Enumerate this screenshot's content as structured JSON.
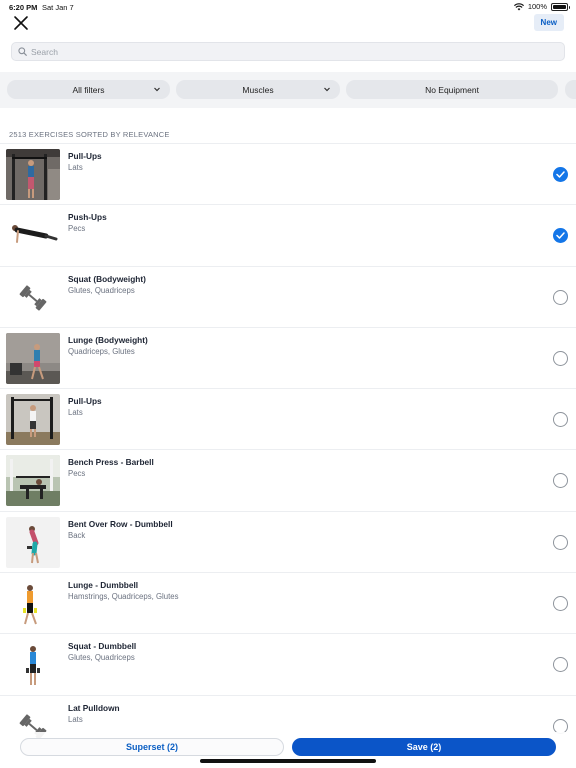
{
  "status_bar": {
    "time": "6:20 PM",
    "date": "Sat Jan 7",
    "battery": "100%"
  },
  "header": {
    "new_label": "New"
  },
  "search": {
    "placeholder": "Search"
  },
  "filters": [
    {
      "label": "All filters",
      "has_dropdown": true
    },
    {
      "label": "Muscles",
      "has_dropdown": true
    },
    {
      "label": "No Equipment",
      "has_dropdown": false
    }
  ],
  "list_header": "2513 EXERCISES SORTED BY RELEVANCE",
  "exercises": [
    {
      "name": "Pull-Ups",
      "muscles": "Lats",
      "selected": true,
      "thumb": "photo-gym-pullup"
    },
    {
      "name": "Push-Ups",
      "muscles": "Pecs",
      "selected": true,
      "thumb": "figure-pushup"
    },
    {
      "name": "Squat (Bodyweight)",
      "muscles": "Glutes, Quadriceps",
      "selected": false,
      "thumb": "dumbbell-icon"
    },
    {
      "name": "Lunge (Bodyweight)",
      "muscles": "Quadriceps, Glutes",
      "selected": false,
      "thumb": "photo-gym-lunge"
    },
    {
      "name": "Pull-Ups",
      "muscles": "Lats",
      "selected": false,
      "thumb": "photo-gym-rig"
    },
    {
      "name": "Bench Press - Barbell",
      "muscles": "Pecs",
      "selected": false,
      "thumb": "photo-outdoor-bench"
    },
    {
      "name": "Bent Over Row - Dumbbell",
      "muscles": "Back",
      "selected": false,
      "thumb": "figure-row"
    },
    {
      "name": "Lunge - Dumbbell",
      "muscles": "Hamstrings, Quadriceps, Glutes",
      "selected": false,
      "thumb": "figure-lunge"
    },
    {
      "name": "Squat - Dumbbell",
      "muscles": "Glutes, Quadriceps",
      "selected": false,
      "thumb": "figure-squat"
    },
    {
      "name": "Lat Pulldown",
      "muscles": "Lats",
      "selected": false,
      "thumb": "dumbbell-icon"
    }
  ],
  "actions": {
    "superset_label": "Superset (2)",
    "save_label": "Save (2)"
  },
  "colors": {
    "accent": "#0b55c8",
    "check": "#1476e8"
  }
}
